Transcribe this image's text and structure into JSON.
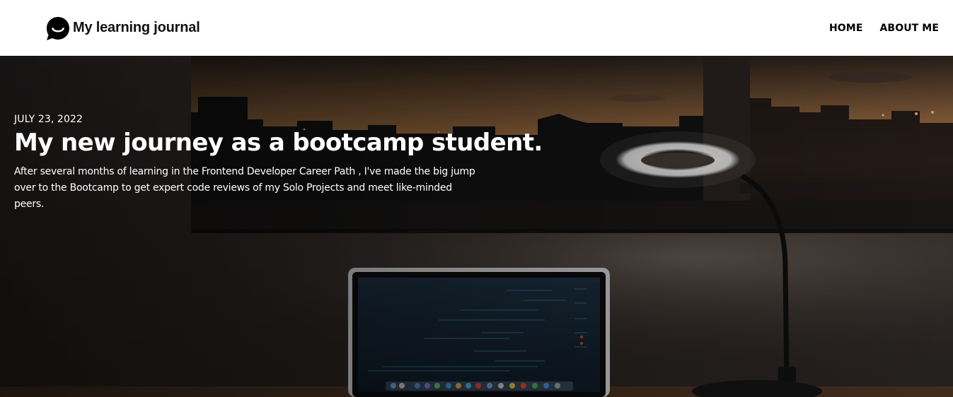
{
  "header": {
    "brand_title": "My learning journal",
    "brand_icon": "chat-bubble-smile-icon",
    "nav": [
      {
        "label": "HOME"
      },
      {
        "label": "ABOUT ME"
      }
    ]
  },
  "hero": {
    "date": "JULY 23, 2022",
    "title": "My new journey as a bootcamp student.",
    "description": "After several months of learning in the Frontend Developer Career Path , I've made the big jump over to the Bootcamp to get expert code reviews of my Solo Projects and meet like-minded peers.",
    "image": "desk-lamp-laptop-sunset-window-photo"
  },
  "colors": {
    "header_bg": "#ffffff",
    "hero_text": "#ffffff",
    "sky_sunset": "#c98a4a"
  }
}
